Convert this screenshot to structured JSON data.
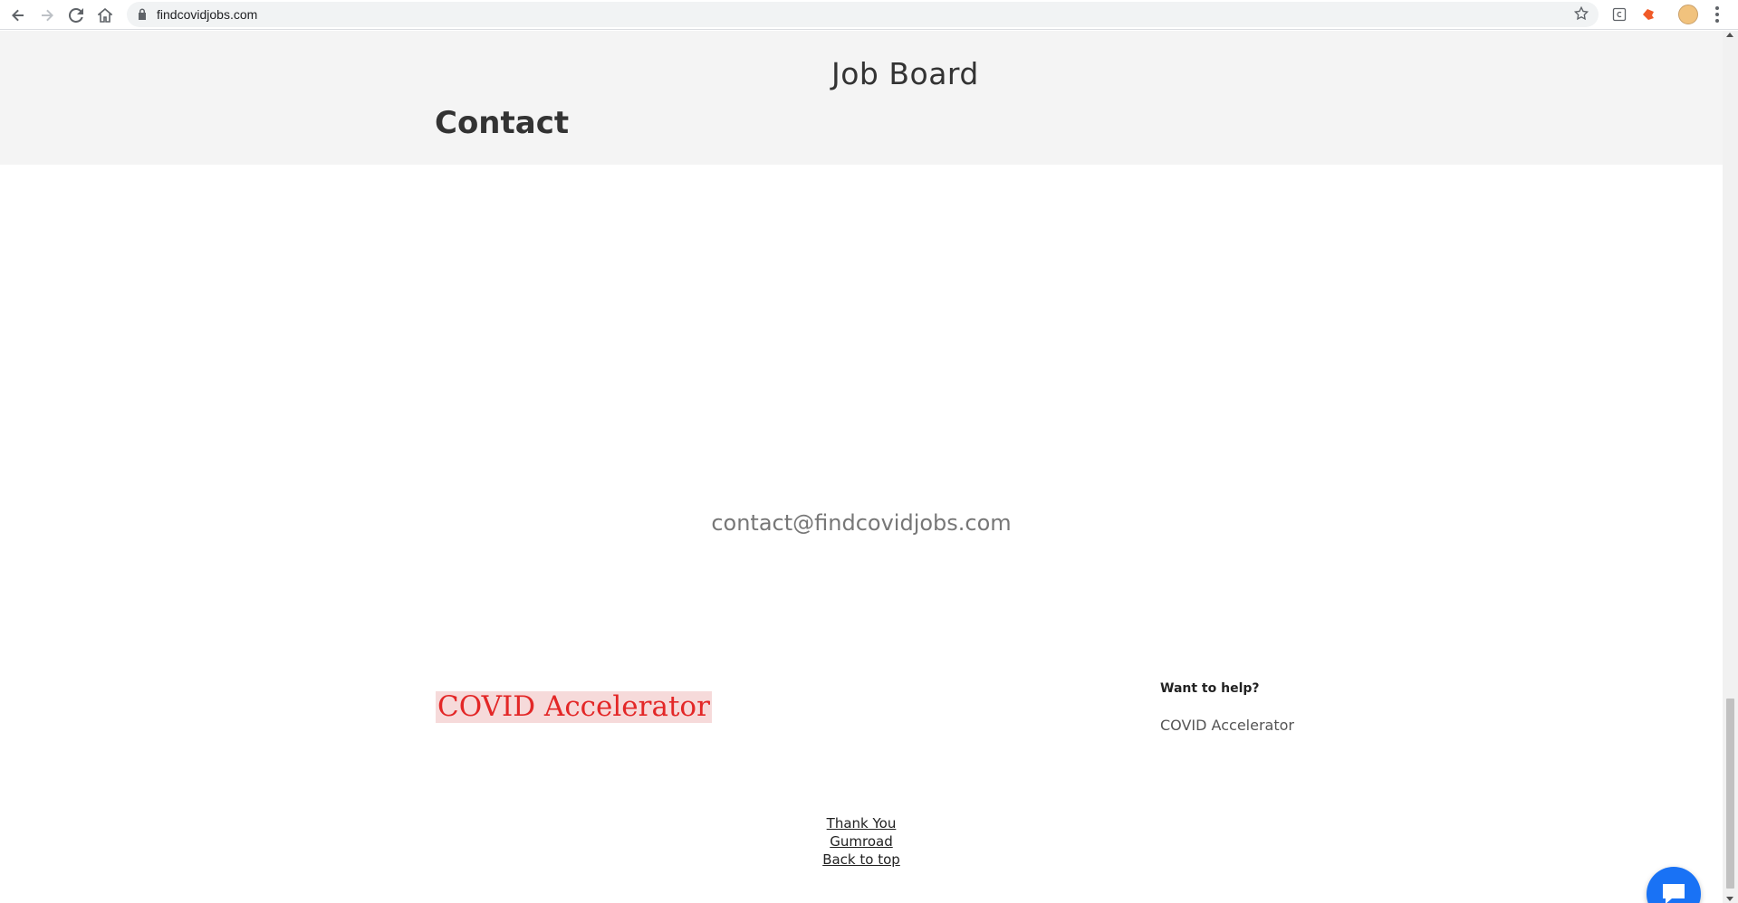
{
  "browser": {
    "url": "findcovidjobs.com"
  },
  "header": {
    "nav_link": "Job Board",
    "page_title": "Contact"
  },
  "main": {
    "email": "contact@findcovidjobs.com"
  },
  "footer": {
    "logo_text": "COVID Accelerator",
    "help_heading": "Want to help?",
    "help_link": "COVID Accelerator",
    "links": [
      "Thank You",
      "Gumroad",
      "Back to top"
    ]
  },
  "colors": {
    "header_bg": "#f4f4f4",
    "logo_red": "#e32727",
    "chat_blue": "#1972f5"
  },
  "icons": {
    "back": "arrow-left-icon",
    "forward": "arrow-right-icon",
    "reload": "reload-icon",
    "home": "home-icon",
    "lock": "lock-icon",
    "bookmark": "star-icon",
    "chat": "chat-bubble-icon"
  }
}
